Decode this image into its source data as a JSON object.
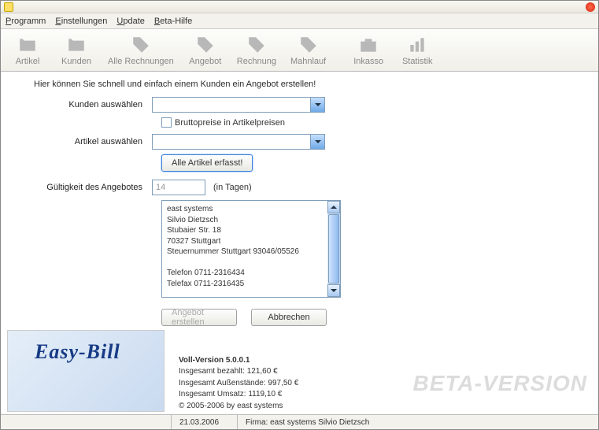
{
  "menu": {
    "programm": "Programm",
    "einstellungen": "Einstellungen",
    "update": "Update",
    "hilfe": "Beta-Hilfe"
  },
  "toolbar": {
    "artikel": "Artikel",
    "kunden": "Kunden",
    "alle": "Alle Rechnungen",
    "angebot": "Angebot",
    "rechnung": "Rechnung",
    "mahnlauf": "Mahnlauf",
    "inkasso": "Inkasso",
    "statistik": "Statistik"
  },
  "intro": "Hier können Sie schnell und einfach einem Kunden ein Angebot erstellen!",
  "form": {
    "kunden_label": "Kunden auswählen",
    "brutto_label": "Bruttopreise in Artikelpreisen",
    "artikel_label": "Artikel auswählen",
    "alle_artikel_btn": "Alle Artikel erfasst!",
    "gueltigkeit_label": "Gültigkeit des Angebotes",
    "gueltigkeit_value": "14",
    "gueltigkeit_unit": "(in Tagen)",
    "address": "east systems\nSilvio Dietzsch\nStubaier Str. 18\n70327 Stuttgart\nSteuernummer Stuttgart 93046/05526\n\nTelefon 0711-2316434\nTelefax 0711-2316435",
    "submit_btn": "Angebot erstellen",
    "cancel_btn": "Abbrechen"
  },
  "logo": "Easy-Bill",
  "version": {
    "title": "Voll-Version 5.0.0.1",
    "paid": "Insgesamt bezahlt: 121,60 €",
    "outstanding": "Insgesamt Außenstände: 997,50 €",
    "revenue": "Insgesamt Umsatz: 1119,10 €",
    "copyright": "© 2005-2006 by east systems"
  },
  "beta": "BETA-VERSION",
  "status": {
    "date": "21.03.2006",
    "firma": "Firma: east systems Silvio Dietzsch"
  }
}
